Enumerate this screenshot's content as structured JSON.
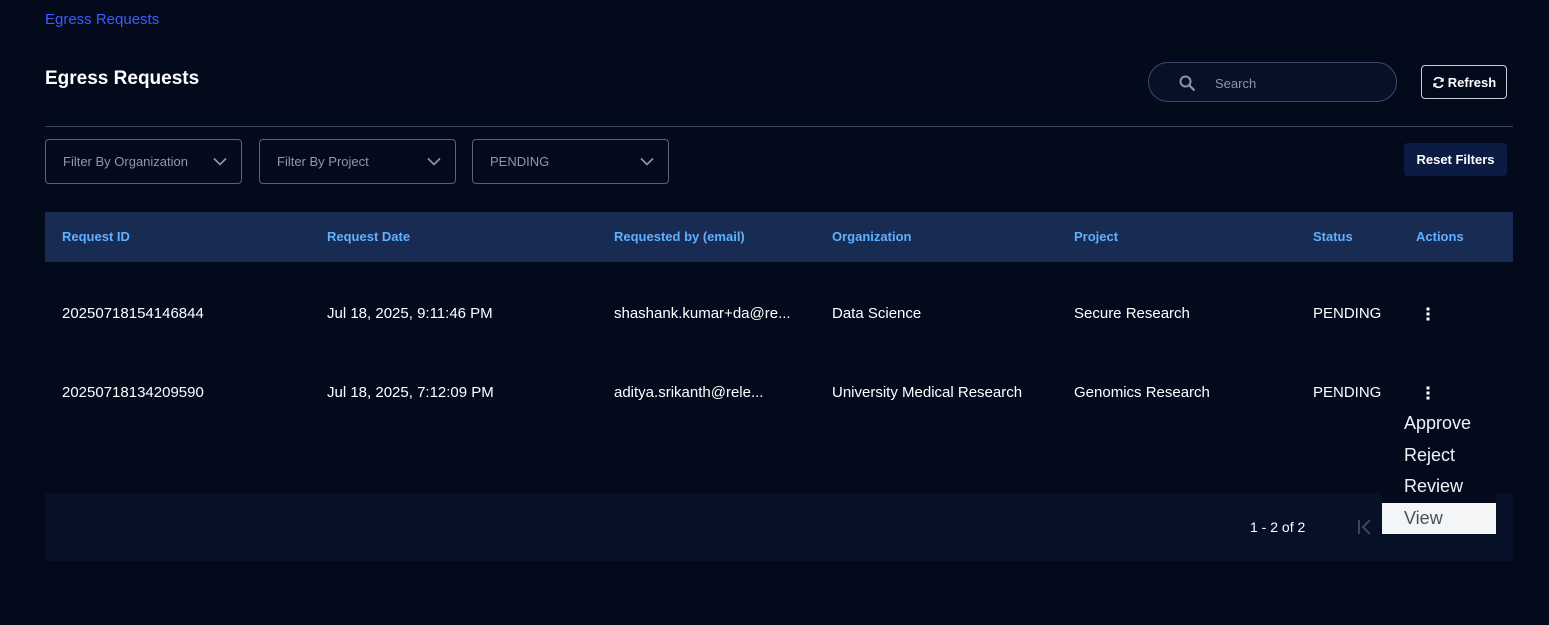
{
  "breadcrumb": "Egress Requests",
  "page_title": "Egress Requests",
  "search": {
    "placeholder": "Search",
    "value": ""
  },
  "refresh_label": "Refresh",
  "filters": {
    "organization": "Filter By Organization",
    "project": "Filter By Project",
    "status": "PENDING"
  },
  "reset_label": "Reset Filters",
  "table": {
    "headers": {
      "request_id": "Request ID",
      "request_date": "Request Date",
      "requested_by": "Requested by (email)",
      "organization": "Organization",
      "project": "Project",
      "status": "Status",
      "actions": "Actions"
    },
    "rows": [
      {
        "request_id": "20250718154146844",
        "request_date": "Jul 18, 2025, 9:11:46 PM",
        "requested_by": "shashank.kumar+da@re...",
        "organization": "Data Science",
        "project": "Secure Research",
        "status": "PENDING"
      },
      {
        "request_id": "20250718134209590",
        "request_date": "Jul 18, 2025, 7:12:09 PM",
        "requested_by": "aditya.srikanth@rele...",
        "organization": "University Medical Research",
        "project": "Genomics Research",
        "status": "PENDING"
      }
    ]
  },
  "pagination": {
    "range": "1 - 2 of 2"
  },
  "action_menu": {
    "items": [
      "Approve",
      "Reject",
      "Review",
      "View"
    ],
    "selected": "View"
  },
  "icons": {
    "search": "search-icon",
    "refresh": "refresh-icon",
    "dropdown": "chevron-down-icon",
    "actions": "kebab-menu-icon",
    "first_page": "first-page-icon"
  },
  "colors": {
    "background": "#020a1b",
    "breadcrumb": "#3d5bff",
    "table_header_bg": "#182b52",
    "table_header_text": "#5fb0ff",
    "reset_button_bg": "#0c1b44",
    "footer_bg": "#061128"
  }
}
